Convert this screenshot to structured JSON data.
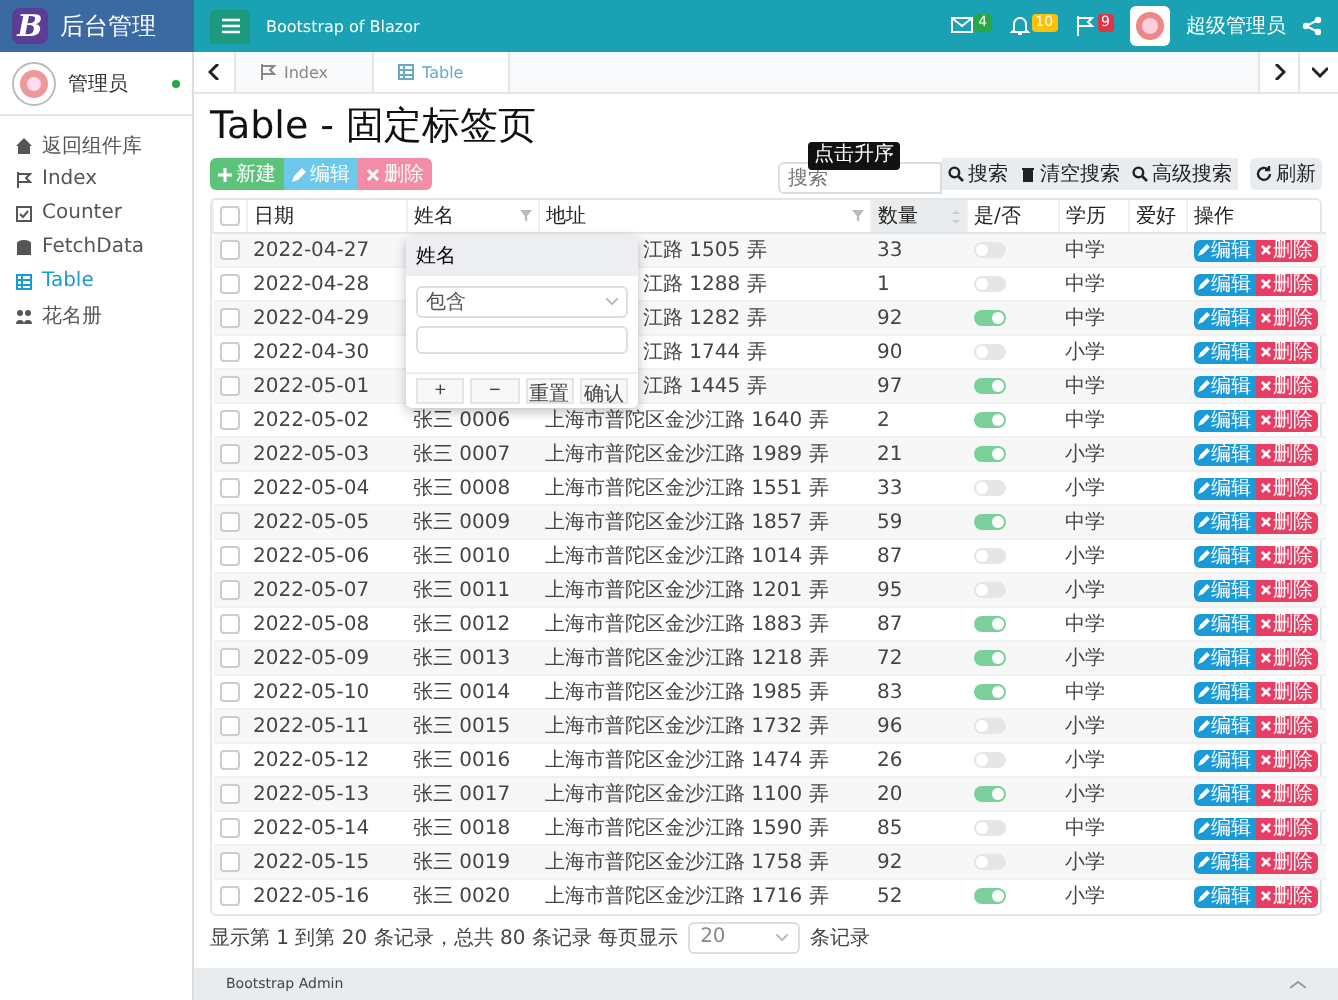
{
  "header": {
    "logo_letter": "B",
    "app_title": "后台管理",
    "site_title": "Bootstrap of Blazor",
    "notifications": [
      {
        "kind": "mail",
        "count": "4",
        "color": "#28a745"
      },
      {
        "kind": "bell",
        "count": "10",
        "color": "#ffc107"
      },
      {
        "kind": "flag",
        "count": "9",
        "color": "#dc3545"
      }
    ],
    "user_name": "超级管理员"
  },
  "sidebar": {
    "user": "管理员",
    "online": true,
    "items": [
      {
        "label": "返回组件库",
        "selected": false
      },
      {
        "label": "Index",
        "selected": false
      },
      {
        "label": "Counter",
        "selected": false
      },
      {
        "label": "FetchData",
        "selected": false
      },
      {
        "label": "Table",
        "selected": true
      },
      {
        "label": "花名册",
        "selected": false
      }
    ]
  },
  "tabs": [
    {
      "label": "Index",
      "selected": false
    },
    {
      "label": "Table",
      "selected": true
    }
  ],
  "page_title": "Table - 固定标签页",
  "toolbar": {
    "buttons": [
      {
        "kind": "add",
        "label": "新建"
      },
      {
        "kind": "edit",
        "label": "编辑"
      },
      {
        "kind": "delete",
        "label": "删除"
      }
    ],
    "search": {
      "placeholder": "搜索"
    },
    "tooltip": "点击升序",
    "search_buttons": [
      {
        "kind": "search",
        "label": "搜索"
      },
      {
        "kind": "clear",
        "label": "清空搜索"
      },
      {
        "kind": "advanced",
        "label": "高级搜索"
      }
    ],
    "refresh": "刷新"
  },
  "table": {
    "select_all": {
      "checked": false
    },
    "columns": [
      "日期",
      "姓名",
      "地址",
      "数量",
      "是/否",
      "学历",
      "爱好",
      "操作"
    ],
    "rows": [
      {
        "date": "2022-04-27",
        "address": "江路 1505 弄",
        "count": "33",
        "on": false,
        "education": "中学",
        "checked": false,
        "edit": "编辑",
        "delete": "删除"
      },
      {
        "date": "2022-04-28",
        "address": "江路 1288 弄",
        "count": "1",
        "on": false,
        "education": "中学",
        "checked": false,
        "edit": "编辑",
        "delete": "删除"
      },
      {
        "date": "2022-04-29",
        "address": "江路 1282 弄",
        "count": "92",
        "on": true,
        "education": "中学",
        "checked": false,
        "edit": "编辑",
        "delete": "删除"
      },
      {
        "date": "2022-04-30",
        "address": "江路 1744 弄",
        "count": "90",
        "on": false,
        "education": "小学",
        "checked": false,
        "edit": "编辑",
        "delete": "删除"
      },
      {
        "date": "2022-05-01",
        "address": "江路 1445 弄",
        "count": "97",
        "on": true,
        "education": "中学",
        "checked": false,
        "edit": "编辑",
        "delete": "删除"
      },
      {
        "date": "2022-05-02",
        "name": "张三 0006",
        "address": "上海市普陀区金沙江路 1640 弄",
        "count": "2",
        "on": true,
        "education": "中学",
        "checked": false,
        "edit": "编辑",
        "delete": "删除"
      },
      {
        "date": "2022-05-03",
        "name": "张三 0007",
        "address": "上海市普陀区金沙江路 1989 弄",
        "count": "21",
        "on": true,
        "education": "小学",
        "checked": false,
        "edit": "编辑",
        "delete": "删除"
      },
      {
        "date": "2022-05-04",
        "name": "张三 0008",
        "address": "上海市普陀区金沙江路 1551 弄",
        "count": "33",
        "on": false,
        "education": "小学",
        "checked": false,
        "edit": "编辑",
        "delete": "删除"
      },
      {
        "date": "2022-05-05",
        "name": "张三 0009",
        "address": "上海市普陀区金沙江路 1857 弄",
        "count": "59",
        "on": true,
        "education": "中学",
        "checked": false,
        "edit": "编辑",
        "delete": "删除"
      },
      {
        "date": "2022-05-06",
        "name": "张三 0010",
        "address": "上海市普陀区金沙江路 1014 弄",
        "count": "87",
        "on": false,
        "education": "小学",
        "checked": false,
        "edit": "编辑",
        "delete": "删除"
      },
      {
        "date": "2022-05-07",
        "name": "张三 0011",
        "address": "上海市普陀区金沙江路 1201 弄",
        "count": "95",
        "on": false,
        "education": "小学",
        "checked": false,
        "edit": "编辑",
        "delete": "删除"
      },
      {
        "date": "2022-05-08",
        "name": "张三 0012",
        "address": "上海市普陀区金沙江路 1883 弄",
        "count": "87",
        "on": true,
        "education": "中学",
        "checked": false,
        "edit": "编辑",
        "delete": "删除"
      },
      {
        "date": "2022-05-09",
        "name": "张三 0013",
        "address": "上海市普陀区金沙江路 1218 弄",
        "count": "72",
        "on": true,
        "education": "小学",
        "checked": false,
        "edit": "编辑",
        "delete": "删除"
      },
      {
        "date": "2022-05-10",
        "name": "张三 0014",
        "address": "上海市普陀区金沙江路 1985 弄",
        "count": "83",
        "on": true,
        "education": "中学",
        "checked": false,
        "edit": "编辑",
        "delete": "删除"
      },
      {
        "date": "2022-05-11",
        "name": "张三 0015",
        "address": "上海市普陀区金沙江路 1732 弄",
        "count": "96",
        "on": false,
        "education": "小学",
        "checked": false,
        "edit": "编辑",
        "delete": "删除"
      },
      {
        "date": "2022-05-12",
        "name": "张三 0016",
        "address": "上海市普陀区金沙江路 1474 弄",
        "count": "26",
        "on": false,
        "education": "小学",
        "checked": false,
        "edit": "编辑",
        "delete": "删除"
      },
      {
        "date": "2022-05-13",
        "name": "张三 0017",
        "address": "上海市普陀区金沙江路 1100 弄",
        "count": "20",
        "on": true,
        "education": "小学",
        "checked": false,
        "edit": "编辑",
        "delete": "删除"
      },
      {
        "date": "2022-05-14",
        "name": "张三 0018",
        "address": "上海市普陀区金沙江路 1590 弄",
        "count": "85",
        "on": false,
        "education": "中学",
        "checked": false,
        "edit": "编辑",
        "delete": "删除"
      },
      {
        "date": "2022-05-15",
        "name": "张三 0019",
        "address": "上海市普陀区金沙江路 1758 弄",
        "count": "92",
        "on": false,
        "education": "小学",
        "checked": false,
        "edit": "编辑",
        "delete": "删除"
      },
      {
        "date": "2022-05-16",
        "name": "张三 0020",
        "address": "上海市普陀区金沙江路 1716 弄",
        "count": "52",
        "on": true,
        "education": "小学",
        "checked": false,
        "edit": "编辑",
        "delete": "删除"
      }
    ]
  },
  "filter_popup": {
    "title": "姓名",
    "operator": "包含",
    "buttons": [
      "+",
      "−",
      "重置",
      "确认"
    ]
  },
  "pagination": {
    "summary": "显示第 1 到第 20 条记录，总共 80 条记录 每页显示",
    "page_size": "20",
    "suffix": "条记录"
  },
  "footer": {
    "text": "Bootstrap Admin"
  }
}
